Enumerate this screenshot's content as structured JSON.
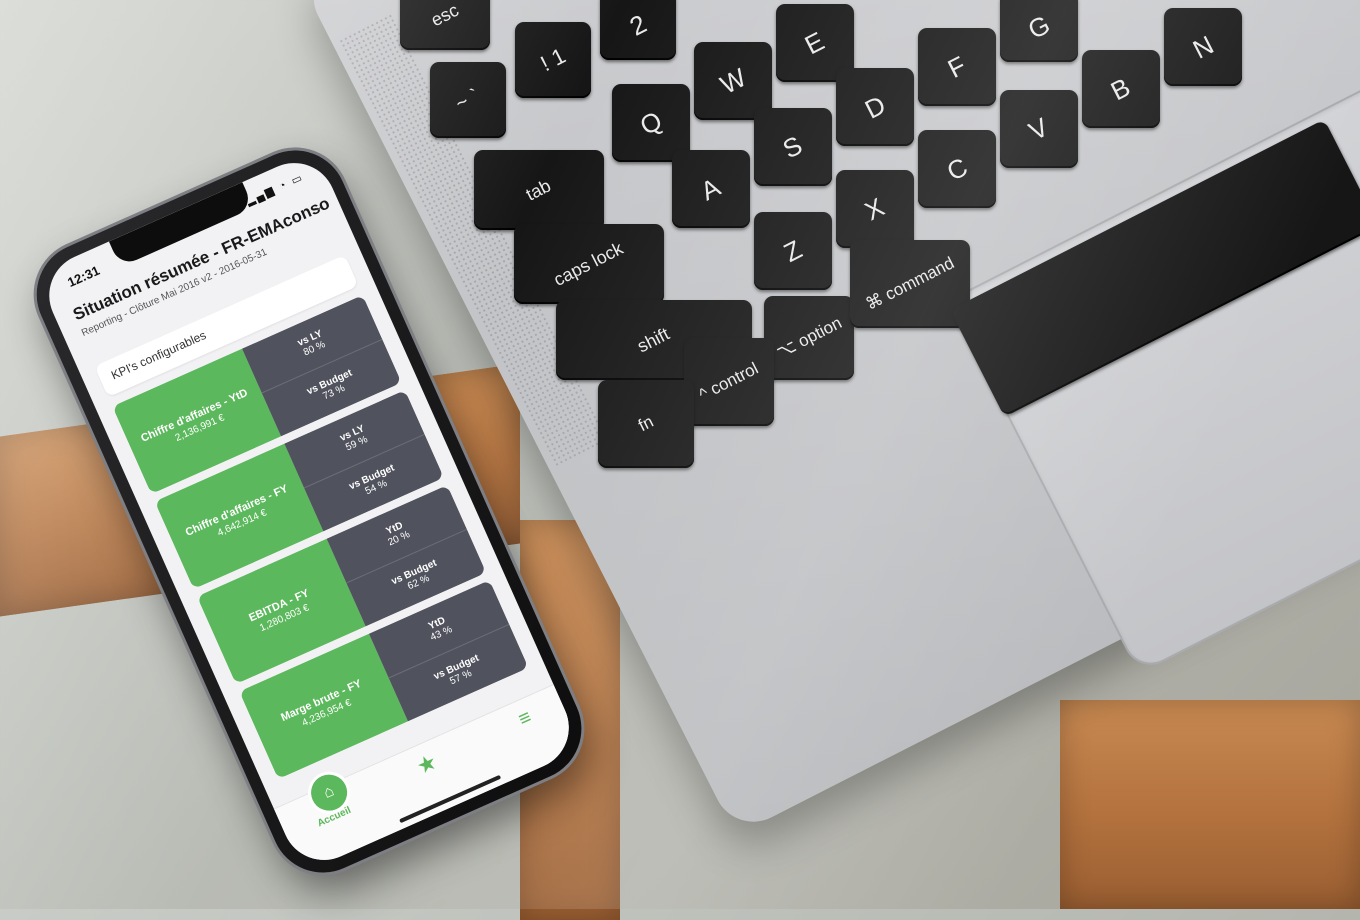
{
  "phone": {
    "status_time": "12:31",
    "title": "Situation résumée - FR-EMAconso",
    "subtitle": "Reporting - Clôture Mai 2016 v2 - 2016-05-31",
    "section_label": "KPI's configurables",
    "kpis": [
      {
        "name": "Chiffre d'affaires - YtD",
        "value": "2,136,991 €",
        "cmp1_label": "vs LY",
        "cmp1_value": "80 %",
        "cmp2_label": "vs Budget",
        "cmp2_value": "73 %"
      },
      {
        "name": "Chiffre d'affaires - FY",
        "value": "4,642,914 €",
        "cmp1_label": "vs LY",
        "cmp1_value": "59 %",
        "cmp2_label": "vs Budget",
        "cmp2_value": "54 %"
      },
      {
        "name": "EBITDA - FY",
        "value": "1,280,803 €",
        "cmp1_label": "YtD",
        "cmp1_value": "20 %",
        "cmp2_label": "vs Budget",
        "cmp2_value": "62 %"
      },
      {
        "name": "Marge brute - FY",
        "value": "4,236,954 €",
        "cmp1_label": "YtD",
        "cmp1_value": "43 %",
        "cmp2_label": "vs Budget",
        "cmp2_value": "57 %"
      }
    ],
    "tabbar": {
      "home_label": "Accueil",
      "home_icon": "home-icon",
      "star_icon": "star-icon",
      "menu_icon": "menu-icon"
    }
  },
  "keyboard": {
    "keys": [
      "esc",
      "~ `",
      "! 1",
      "2",
      "Q",
      "W",
      "E",
      "tab",
      "A",
      "S",
      "D",
      "F",
      "G",
      "caps lock",
      "Z",
      "X",
      "C",
      "V",
      "B",
      "N",
      "shift",
      "⌥ option",
      "⌘ command",
      "^ control",
      "fn"
    ]
  }
}
